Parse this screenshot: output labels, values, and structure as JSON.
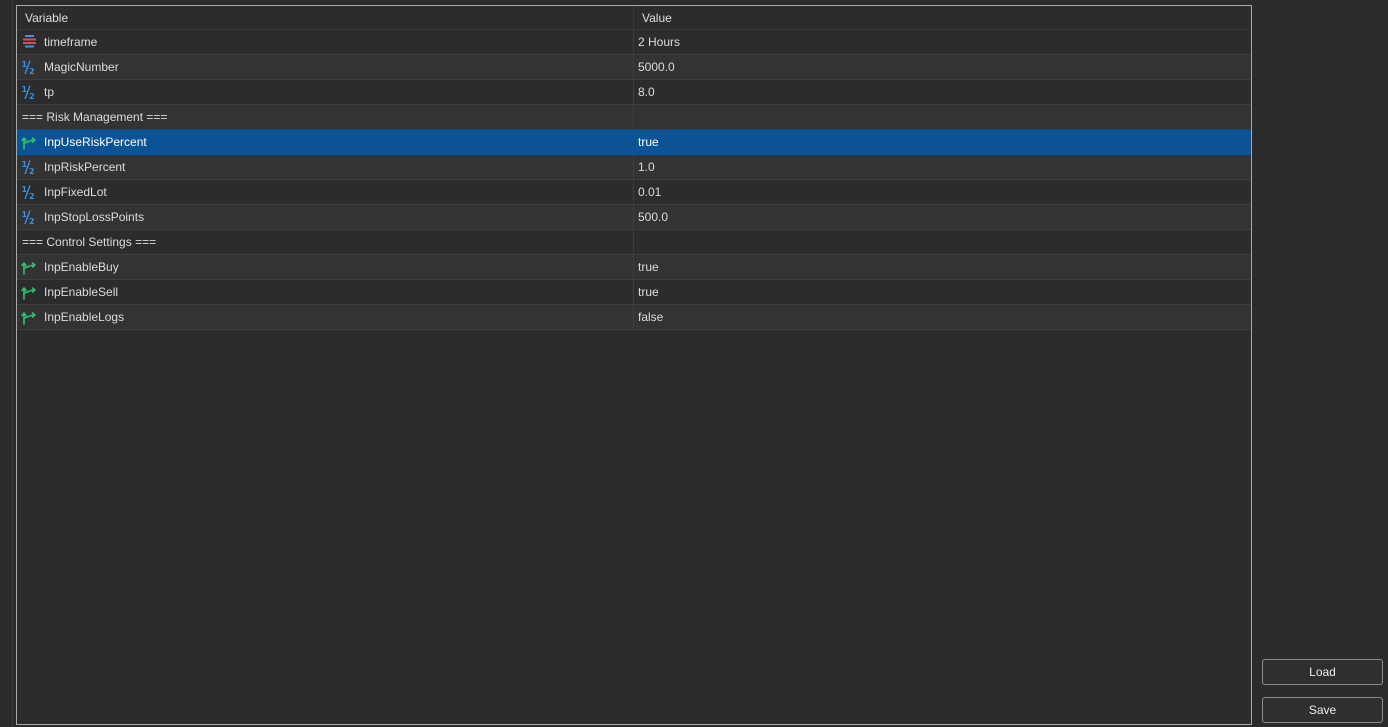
{
  "table": {
    "headers": {
      "variable": "Variable",
      "value": "Value"
    },
    "rows": [
      {
        "type": "param",
        "icon": "enum-icon",
        "name": "timeframe",
        "value": "2 Hours"
      },
      {
        "type": "param",
        "icon": "number-half-icon",
        "name": "MagicNumber",
        "value": "5000.0"
      },
      {
        "type": "param",
        "icon": "number-half-icon",
        "name": "tp",
        "value": "8.0"
      },
      {
        "type": "group",
        "name": "=== Risk Management ===",
        "value": ""
      },
      {
        "type": "param",
        "icon": "bool-arrow-icon",
        "name": "InpUseRiskPercent",
        "value": "true",
        "selected": true
      },
      {
        "type": "param",
        "icon": "number-half-icon",
        "name": "InpRiskPercent",
        "value": "1.0"
      },
      {
        "type": "param",
        "icon": "number-half-icon",
        "name": "InpFixedLot",
        "value": "0.01"
      },
      {
        "type": "param",
        "icon": "number-half-icon",
        "name": "InpStopLossPoints",
        "value": "500.0"
      },
      {
        "type": "group",
        "name": "=== Control Settings ===",
        "value": ""
      },
      {
        "type": "param",
        "icon": "bool-arrow-icon",
        "name": "InpEnableBuy",
        "value": "true"
      },
      {
        "type": "param",
        "icon": "bool-arrow-icon",
        "name": "InpEnableSell",
        "value": "true"
      },
      {
        "type": "param",
        "icon": "bool-arrow-icon",
        "name": "InpEnableLogs",
        "value": "false"
      }
    ]
  },
  "buttons": {
    "load_label": "Load",
    "save_label": "Save"
  },
  "colors": {
    "selection": "#0b5394",
    "background": "#2b2b2b",
    "bool_icon": "#2fbf71",
    "number_icon": "#3b8fe0"
  }
}
